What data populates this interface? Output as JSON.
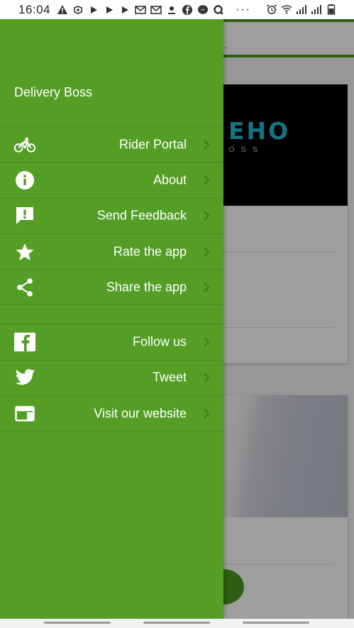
{
  "status_bar": {
    "time": "16:04",
    "left_icons": [
      "alert-icon",
      "notification-icon",
      "play-icon",
      "play-icon",
      "play-icon",
      "mail-icon",
      "mail-icon",
      "weather-icon",
      "facebook-icon",
      "messenger-icon",
      "search-app-icon"
    ],
    "overflow": "···",
    "right_icons": [
      "alarm-icon",
      "wifi-icon",
      "signal-icon",
      "signal-icon",
      "battery-icon"
    ]
  },
  "drawer": {
    "title": "Delivery Boss",
    "items": [
      {
        "label": "Rider Portal",
        "icon": "bicycle-icon"
      },
      {
        "label": "About",
        "icon": "info-icon"
      },
      {
        "label": "Send Feedback",
        "icon": "feedback-icon"
      },
      {
        "label": "Rate the app",
        "icon": "star-icon"
      },
      {
        "label": "Share the app",
        "icon": "share-icon"
      },
      {
        "label": "Follow us",
        "icon": "facebook-icon"
      },
      {
        "label": "Tweet",
        "icon": "twitter-icon"
      },
      {
        "label": "Visit our website",
        "icon": "web-icon"
      }
    ]
  },
  "background": {
    "banner_text_main": "EHO",
    "banner_text_sub": "OSS",
    "appbar_text": "."
  },
  "colors": {
    "drawer_bg": "#549e25",
    "accent": "#4c9a1e",
    "banner_logo": "#2ab7d0"
  }
}
